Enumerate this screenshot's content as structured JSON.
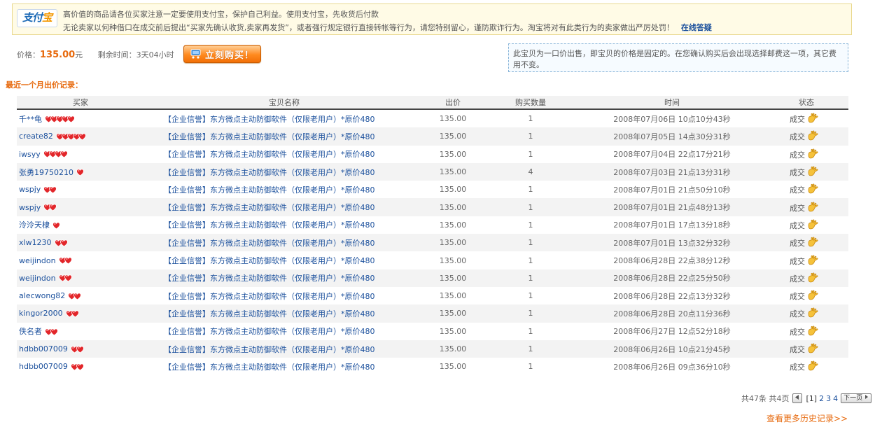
{
  "notice": {
    "logo_text_a": "支付",
    "logo_text_b": "宝",
    "line1": "高价值的商品请各位买家注意一定要使用支付宝，保护自己利益。使用支付宝，先收货后付款",
    "line2": "无论卖家以何种借口在成交前后提出“买家先确认收货,卖家再发货”，或者强行规定银行直接转帐等行为，请您特别留心，谨防欺诈行为。淘宝将对有此类行为的卖家做出严厉处罚！",
    "online_help": "在线答疑"
  },
  "price_bar": {
    "price_label": "价格：",
    "price_value": "135.00",
    "price_unit": "元",
    "remaining_label": "剩余时间：",
    "remaining_value": "3天04小时",
    "buy_label": "立刻购买！"
  },
  "fixed_price_note": "此宝贝为一口价出售，即宝贝的价格是固定的。在您确认购买后会出现选择邮费这一项，其它费用不变。",
  "section_title": "最近一个月出价记录：",
  "table": {
    "columns": [
      "买家",
      "宝贝名称",
      "出价",
      "购买数量",
      "时间",
      "状态"
    ],
    "rows": [
      {
        "buyer": "千**龟",
        "hearts": 5,
        "item": "【企业信誉】东方微点主动防御软件（仅限老用户）*原价480",
        "price": "135.00",
        "qty": "1",
        "time": "2008年07月06日 10点10分43秒",
        "status": "成交"
      },
      {
        "buyer": "create82",
        "hearts": 5,
        "item": "【企业信誉】东方微点主动防御软件（仅限老用户）*原价480",
        "price": "135.00",
        "qty": "1",
        "time": "2008年07月05日 14点30分31秒",
        "status": "成交"
      },
      {
        "buyer": "iwsyy",
        "hearts": 4,
        "item": "【企业信誉】东方微点主动防御软件（仅限老用户）*原价480",
        "price": "135.00",
        "qty": "1",
        "time": "2008年07月04日 22点17分21秒",
        "status": "成交"
      },
      {
        "buyer": "张勇19750210",
        "hearts": 1,
        "item": "【企业信誉】东方微点主动防御软件（仅限老用户）*原价480",
        "price": "135.00",
        "qty": "4",
        "time": "2008年07月03日 21点13分31秒",
        "status": "成交"
      },
      {
        "buyer": "wspjy",
        "hearts": 2,
        "item": "【企业信誉】东方微点主动防御软件（仅限老用户）*原价480",
        "price": "135.00",
        "qty": "1",
        "time": "2008年07月01日 21点50分10秒",
        "status": "成交"
      },
      {
        "buyer": "wspjy",
        "hearts": 2,
        "item": "【企业信誉】东方微点主动防御软件（仅限老用户）*原价480",
        "price": "135.00",
        "qty": "1",
        "time": "2008年07月01日 21点48分13秒",
        "status": "成交"
      },
      {
        "buyer": "泠泠天棣",
        "hearts": 1,
        "item": "【企业信誉】东方微点主动防御软件（仅限老用户）*原价480",
        "price": "135.00",
        "qty": "1",
        "time": "2008年07月01日 17点13分18秒",
        "status": "成交"
      },
      {
        "buyer": "xlw1230",
        "hearts": 2,
        "item": "【企业信誉】东方微点主动防御软件（仅限老用户）*原价480",
        "price": "135.00",
        "qty": "1",
        "time": "2008年07月01日 13点32分32秒",
        "status": "成交"
      },
      {
        "buyer": "weijindon",
        "hearts": 2,
        "item": "【企业信誉】东方微点主动防御软件（仅限老用户）*原价480",
        "price": "135.00",
        "qty": "1",
        "time": "2008年06月28日 22点38分12秒",
        "status": "成交"
      },
      {
        "buyer": "weijindon",
        "hearts": 2,
        "item": "【企业信誉】东方微点主动防御软件（仅限老用户）*原价480",
        "price": "135.00",
        "qty": "1",
        "time": "2008年06月28日 22点25分50秒",
        "status": "成交"
      },
      {
        "buyer": "alecwong82",
        "hearts": 2,
        "item": "【企业信誉】东方微点主动防御软件（仅限老用户）*原价480",
        "price": "135.00",
        "qty": "1",
        "time": "2008年06月28日 22点13分32秒",
        "status": "成交"
      },
      {
        "buyer": "kingor2000",
        "hearts": 2,
        "item": "【企业信誉】东方微点主动防御软件（仅限老用户）*原价480",
        "price": "135.00",
        "qty": "1",
        "time": "2008年06月28日 20点11分36秒",
        "status": "成交"
      },
      {
        "buyer": "佚名者",
        "hearts": 2,
        "item": "【企业信誉】东方微点主动防御软件（仅限老用户）*原价480",
        "price": "135.00",
        "qty": "1",
        "time": "2008年06月27日 12点52分18秒",
        "status": "成交"
      },
      {
        "buyer": "hdbb007009",
        "hearts": 2,
        "item": "【企业信誉】东方微点主动防御软件（仅限老用户）*原价480",
        "price": "135.00",
        "qty": "1",
        "time": "2008年06月26日 10点21分45秒",
        "status": "成交"
      },
      {
        "buyer": "hdbb007009",
        "hearts": 2,
        "item": "【企业信誉】东方微点主动防御软件（仅限老用户）*原价480",
        "price": "135.00",
        "qty": "1",
        "time": "2008年06月26日 09点36分10秒",
        "status": "成交"
      }
    ]
  },
  "pagination": {
    "summary": "共47条 共4页",
    "current_page": "[1]",
    "pages": [
      "2",
      "3",
      "4"
    ],
    "next_label": "下一页"
  },
  "more_history": "查看更多历史记录>>",
  "colors": {
    "accent_orange": "#e76a0e",
    "link_blue": "#1a4f9c",
    "heart_red": "#e2262a"
  },
  "icons": {
    "heart": "heart-icon",
    "hand": "hand-icon",
    "cart": "cart-icon"
  }
}
